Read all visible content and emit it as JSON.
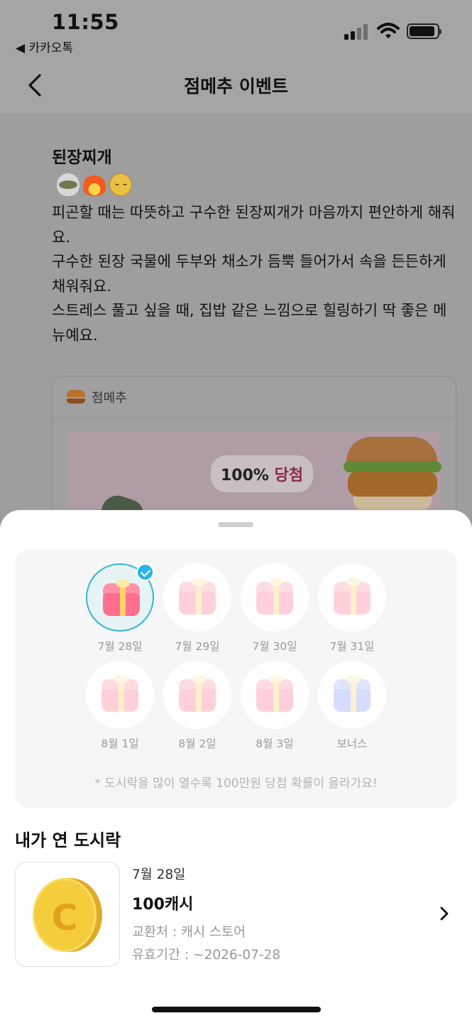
{
  "status_bar": {
    "time": "11:55",
    "back_app": "◀ 카카오톡"
  },
  "nav": {
    "title": "점메추 이벤트"
  },
  "post": {
    "menu_name": "된장찌개",
    "description": "피곤할 때는 따뜻하고 구수한 된장찌개가 마음까지 편안하게 해줘요.\n구수한 된장 국물에 두부와 채소가 듬뿍 들어가서 속을 든든하게 채워줘요.\n스트레스 풀고 싶을 때, 집밥 같은 느낌으로 힐링하기 딱 좋은 메뉴예요.",
    "card_label": "점메추",
    "banner_badge_prefix": "100%",
    "banner_badge_highlight": "당첨"
  },
  "boxes": {
    "items": [
      {
        "label": "7월 28일",
        "selected": true,
        "opened": true,
        "color": "pink"
      },
      {
        "label": "7월 29일",
        "selected": false,
        "opened": false,
        "color": "pink"
      },
      {
        "label": "7월 30일",
        "selected": false,
        "opened": false,
        "color": "pink"
      },
      {
        "label": "7월 31일",
        "selected": false,
        "opened": false,
        "color": "pink"
      },
      {
        "label": "8월 1일",
        "selected": false,
        "opened": false,
        "color": "pink"
      },
      {
        "label": "8월 2일",
        "selected": false,
        "opened": false,
        "color": "pink"
      },
      {
        "label": "8월 3일",
        "selected": false,
        "opened": false,
        "color": "pink"
      },
      {
        "label": "보너스",
        "selected": false,
        "opened": false,
        "color": "blue"
      }
    ],
    "notice": "* 도시락을 많이 열수록 100만원 당첨 확률이 올라가요!"
  },
  "opened": {
    "title": "내가 연 도시락",
    "reward": {
      "date": "7월 28일",
      "name": "100캐시",
      "place": "교환처 : 캐시 스토어",
      "expiry": "유효기간 : ~2026-07-28",
      "coin_letter": "C"
    }
  },
  "colors": {
    "accent": "#31b8cf",
    "check": "#29b3e8",
    "coin": "#f5cc3c"
  }
}
